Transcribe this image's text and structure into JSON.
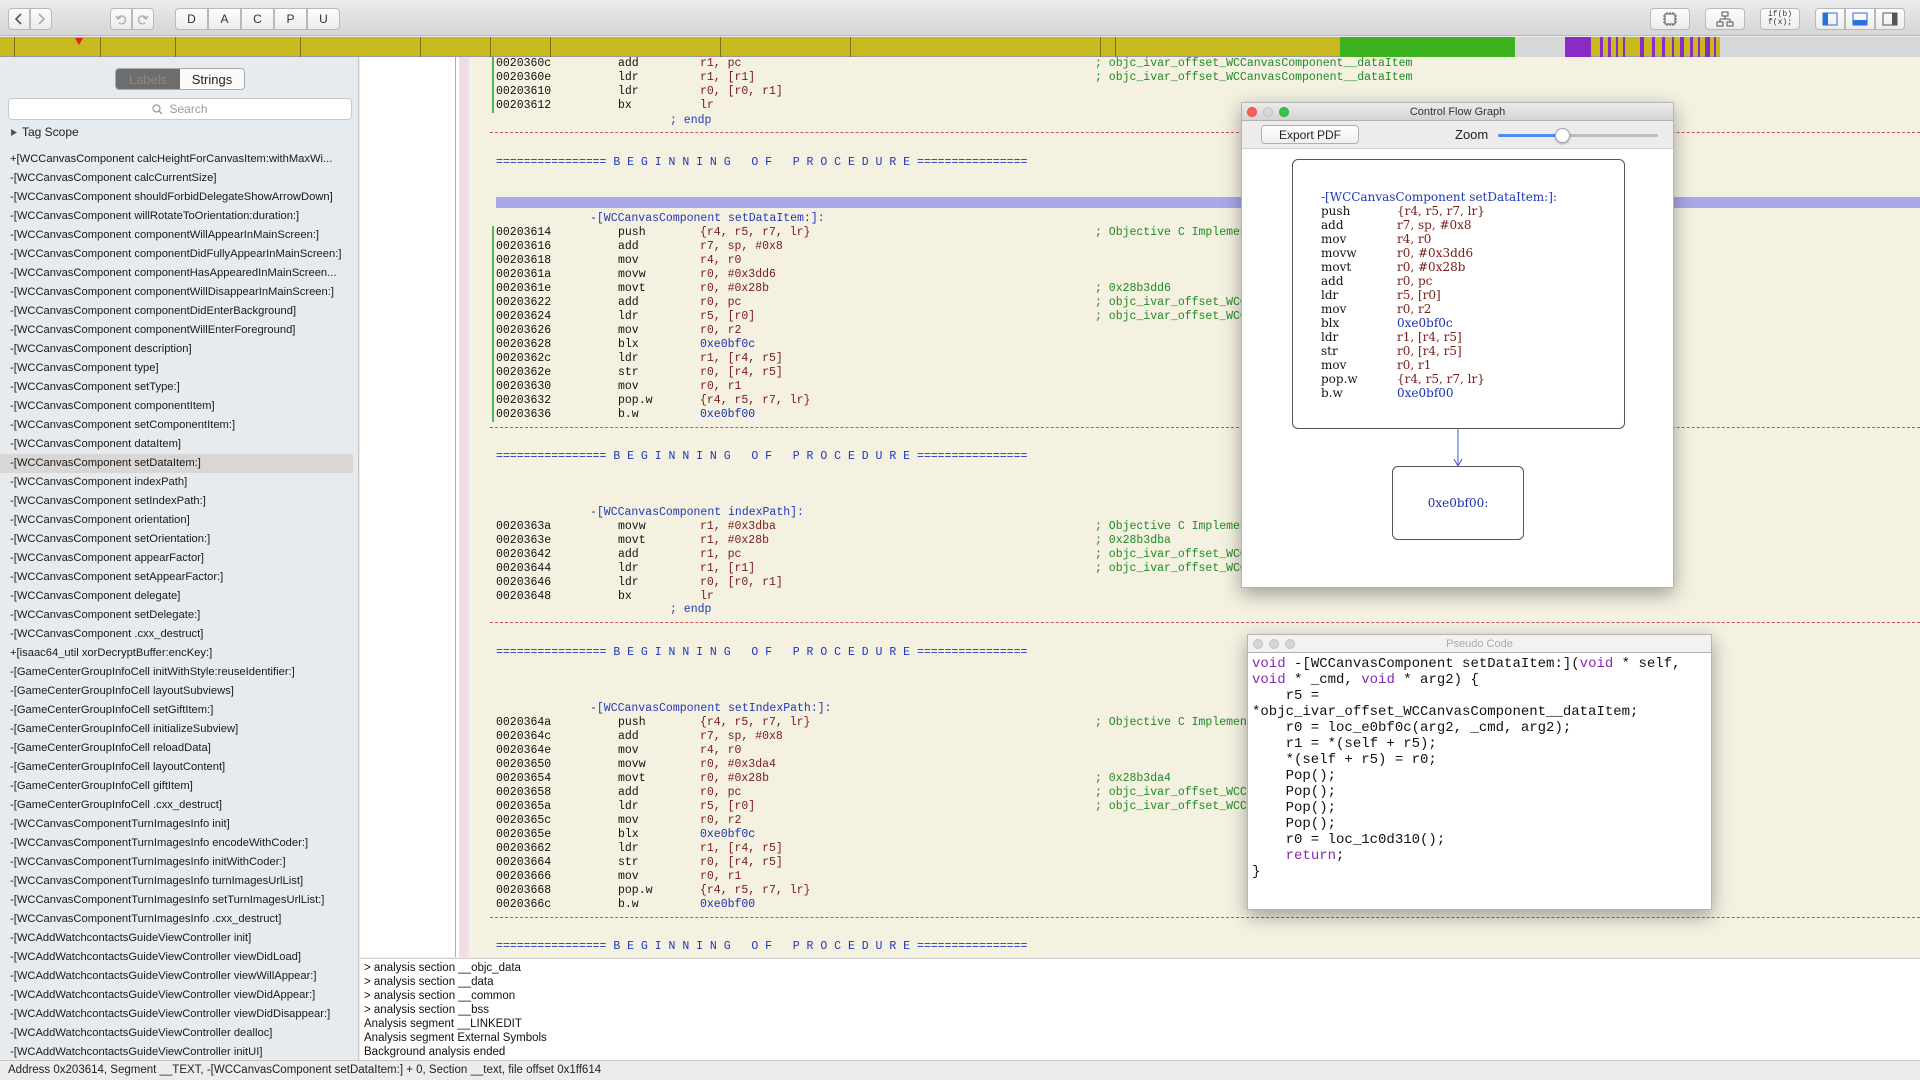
{
  "toolbar": {
    "mode_buttons": [
      "D",
      "A",
      "C",
      "P",
      "U"
    ],
    "pseudo_icon_text": "if(b)\nf(x);"
  },
  "sidebar": {
    "tabs": [
      "Labels",
      "Strings"
    ],
    "active_tab": "Labels",
    "search_placeholder": "Search",
    "tag_scope": "Tag Scope",
    "selected_index": 16,
    "items": [
      "+[WCCanvasComponent calcHeightForCanvasItem:withMaxWi...",
      "-[WCCanvasComponent calcCurrentSize]",
      "-[WCCanvasComponent shouldForbidDelegateShowArrowDown]",
      "-[WCCanvasComponent willRotateToOrientation:duration:]",
      "-[WCCanvasComponent componentWillAppearInMainScreen:]",
      "-[WCCanvasComponent componentDidFullyAppearInMainScreen:]",
      "-[WCCanvasComponent componentHasAppearedInMainScreen...",
      "-[WCCanvasComponent componentWillDisappearInMainScreen:]",
      "-[WCCanvasComponent componentDidEnterBackground]",
      "-[WCCanvasComponent componentWillEnterForeground]",
      "-[WCCanvasComponent description]",
      "-[WCCanvasComponent type]",
      "-[WCCanvasComponent setType:]",
      "-[WCCanvasComponent componentItem]",
      "-[WCCanvasComponent setComponentItem:]",
      "-[WCCanvasComponent dataItem]",
      "-[WCCanvasComponent setDataItem:]",
      "-[WCCanvasComponent indexPath]",
      "-[WCCanvasComponent setIndexPath:]",
      "-[WCCanvasComponent orientation]",
      "-[WCCanvasComponent setOrientation:]",
      "-[WCCanvasComponent appearFactor]",
      "-[WCCanvasComponent setAppearFactor:]",
      "-[WCCanvasComponent delegate]",
      "-[WCCanvasComponent setDelegate:]",
      "-[WCCanvasComponent .cxx_destruct]",
      "+[isaac64_util xorDecryptBuffer:encKey:]",
      "-[GameCenterGroupInfoCell initWithStyle:reuseIdentifier:]",
      "-[GameCenterGroupInfoCell layoutSubviews]",
      "-[GameCenterGroupInfoCell setGiftItem:]",
      "-[GameCenterGroupInfoCell initializeSubview]",
      "-[GameCenterGroupInfoCell reloadData]",
      "-[GameCenterGroupInfoCell layoutContent]",
      "-[GameCenterGroupInfoCell giftItem]",
      "-[GameCenterGroupInfoCell .cxx_destruct]",
      "-[WCCanvasComponentTurnImagesInfo init]",
      "-[WCCanvasComponentTurnImagesInfo encodeWithCoder:]",
      "-[WCCanvasComponentTurnImagesInfo initWithCoder:]",
      "-[WCCanvasComponentTurnImagesInfo turnImagesUrlList]",
      "-[WCCanvasComponentTurnImagesInfo setTurnImagesUrlList:]",
      "-[WCCanvasComponentTurnImagesInfo .cxx_destruct]",
      "-[WCAddWatchcontactsGuideViewController init]",
      "-[WCAddWatchcontactsGuideViewController viewDidLoad]",
      "-[WCAddWatchcontactsGuideViewController viewWillAppear:]",
      "-[WCAddWatchcontactsGuideViewController viewDidAppear:]",
      "-[WCAddWatchcontactsGuideViewController viewDidDisappear:]",
      "-[WCAddWatchcontactsGuideViewController dealloc]",
      "-[WCAddWatchcontactsGuideViewController initUI]"
    ]
  },
  "code": {
    "proc_banner": "================ B E G I N N I N G   O F   P R O C E D U R E ================",
    "endp": "; endp",
    "block0": [
      {
        "a": "0020360c",
        "m": "add",
        "o": "r1, pc",
        "c": "; objc_ivar_offset_WCCanvasComponent__dataItem"
      },
      {
        "a": "0020360e",
        "m": "ldr",
        "o": "r1, [r1]",
        "c": "; objc_ivar_offset_WCCanvasComponent__dataItem"
      },
      {
        "a": "00203610",
        "m": "ldr",
        "o": "r0, [r0, r1]",
        "c": ""
      },
      {
        "a": "00203612",
        "m": "bx",
        "o": "lr",
        "c": ""
      }
    ],
    "proc1_name": "-[WCCanvasComponent setDataItem:]:",
    "block1": [
      {
        "a": "00203614",
        "m": "push",
        "o": "{r4, r5, r7, lr}",
        "c": "; Objective C Implement"
      },
      {
        "a": "00203616",
        "m": "add",
        "o": "r7, sp, #0x8",
        "c": ""
      },
      {
        "a": "00203618",
        "m": "mov",
        "o": "r4, r0",
        "c": ""
      },
      {
        "a": "0020361a",
        "m": "movw",
        "o": "r0, #0x3dd6",
        "c": ""
      },
      {
        "a": "0020361e",
        "m": "movt",
        "o": "r0, #0x28b",
        "c": "; 0x28b3dd6"
      },
      {
        "a": "00203622",
        "m": "add",
        "o": "r0, pc",
        "c": "; objc_ivar_offset_WCCa"
      },
      {
        "a": "00203624",
        "m": "ldr",
        "o": "r5, [r0]",
        "c": "; objc_ivar_offset_WCCa"
      },
      {
        "a": "00203626",
        "m": "mov",
        "o": "r0, r2",
        "c": ""
      },
      {
        "a": "00203628",
        "m": "blx",
        "o": "0xe0bf0c",
        "c": ""
      },
      {
        "a": "0020362c",
        "m": "ldr",
        "o": "r1, [r4, r5]",
        "c": ""
      },
      {
        "a": "0020362e",
        "m": "str",
        "o": "r0, [r4, r5]",
        "c": ""
      },
      {
        "a": "00203630",
        "m": "mov",
        "o": "r0, r1",
        "c": ""
      },
      {
        "a": "00203632",
        "m": "pop.w",
        "o": "{r4, r5, r7, lr}",
        "c": ""
      },
      {
        "a": "00203636",
        "m": "b.w",
        "o": "0xe0bf00",
        "c": ""
      }
    ],
    "proc2_name": "-[WCCanvasComponent indexPath]:",
    "block2": [
      {
        "a": "0020363a",
        "m": "movw",
        "o": "r1, #0x3dba",
        "c": "; Objective C Implement"
      },
      {
        "a": "0020363e",
        "m": "movt",
        "o": "r1, #0x28b",
        "c": "; 0x28b3dba"
      },
      {
        "a": "00203642",
        "m": "add",
        "o": "r1, pc",
        "c": "; objc_ivar_offset_WCCa"
      },
      {
        "a": "00203644",
        "m": "ldr",
        "o": "r1, [r1]",
        "c": "; objc_ivar_offset_WCCa"
      },
      {
        "a": "00203646",
        "m": "ldr",
        "o": "r0, [r0, r1]",
        "c": ""
      },
      {
        "a": "00203648",
        "m": "bx",
        "o": "lr",
        "c": ""
      }
    ],
    "proc3_name": "-[WCCanvasComponent setIndexPath:]:",
    "block3": [
      {
        "a": "0020364a",
        "m": "push",
        "o": "{r4, r5, r7, lr}",
        "c": "; Objective C Implementa"
      },
      {
        "a": "0020364c",
        "m": "add",
        "o": "r7, sp, #0x8",
        "c": ""
      },
      {
        "a": "0020364e",
        "m": "mov",
        "o": "r4, r0",
        "c": ""
      },
      {
        "a": "00203650",
        "m": "movw",
        "o": "r0, #0x3da4",
        "c": ""
      },
      {
        "a": "00203654",
        "m": "movt",
        "o": "r0, #0x28b",
        "c": "; 0x28b3da4"
      },
      {
        "a": "00203658",
        "m": "add",
        "o": "r0, pc",
        "c": "; objc_ivar_offset_WCCan"
      },
      {
        "a": "0020365a",
        "m": "ldr",
        "o": "r5, [r0]",
        "c": "; objc_ivar_offset_WCCan"
      },
      {
        "a": "0020365c",
        "m": "mov",
        "o": "r0, r2",
        "c": ""
      },
      {
        "a": "0020365e",
        "m": "blx",
        "o": "0xe0bf0c",
        "c": ""
      },
      {
        "a": "00203662",
        "m": "ldr",
        "o": "r1, [r4, r5]",
        "c": ""
      },
      {
        "a": "00203664",
        "m": "str",
        "o": "r0, [r4, r5]",
        "c": ""
      },
      {
        "a": "00203666",
        "m": "mov",
        "o": "r0, r1",
        "c": ""
      },
      {
        "a": "00203668",
        "m": "pop.w",
        "o": "{r4, r5, r7, lr}",
        "c": ""
      },
      {
        "a": "0020366c",
        "m": "b.w",
        "o": "0xe0bf00",
        "c": ""
      }
    ]
  },
  "log": [
    "> analysis section __objc_data",
    "> analysis section __data",
    "> analysis section __common",
    "> analysis section __bss",
    "Analysis segment __LINKEDIT",
    "Analysis segment External Symbols",
    "Background analysis ended"
  ],
  "status": "Address 0x203614, Segment __TEXT, -[WCCanvasComponent setDataItem:] + 0, Section __text, file offset 0x1ff614",
  "cfg": {
    "title": "Control Flow Graph",
    "export_label": "Export PDF",
    "zoom_label": "Zoom",
    "zoom_value": 0.4,
    "node1_title": "-[WCCanvasComponent setDataItem:]:",
    "node1_lines": [
      {
        "m": "push",
        "o": "{r4, r5, r7, lr}"
      },
      {
        "m": "add",
        "o": "r7, sp, #0x8"
      },
      {
        "m": "mov",
        "o": "r4, r0"
      },
      {
        "m": "movw",
        "o": "r0, #0x3dd6"
      },
      {
        "m": "movt",
        "o": "r0, #0x28b"
      },
      {
        "m": "add",
        "o": "r0, pc"
      },
      {
        "m": "ldr",
        "o": "r5, [r0]"
      },
      {
        "m": "mov",
        "o": "r0, r2"
      },
      {
        "m": "blx",
        "o": "0xe0bf0c"
      },
      {
        "m": "ldr",
        "o": "r1, [r4, r5]"
      },
      {
        "m": "str",
        "o": "r0, [r4, r5]"
      },
      {
        "m": "mov",
        "o": "r0, r1"
      },
      {
        "m": "pop.w",
        "o": "{r4, r5, r7, lr}"
      },
      {
        "m": "b.w",
        "o": "0xe0bf00"
      }
    ],
    "node2_label": "0xe0bf00:"
  },
  "pseudo": {
    "title": "Pseudo Code",
    "lines": [
      "void -[WCCanvasComponent setDataItem:](void * self,",
      "void * _cmd, void * arg2) {",
      "    r5 =",
      "*objc_ivar_offset_WCCanvasComponent__dataItem;",
      "    r0 = loc_e0bf0c(arg2, _cmd, arg2);",
      "    r1 = *(self + r5);",
      "    *(self + r5) = r0;",
      "    Pop();",
      "    Pop();",
      "    Pop();",
      "    Pop();",
      "    r0 = loc_1c0d310();",
      "    return;",
      "}"
    ]
  },
  "colors": {
    "nav_yellow": "#c8ba1e",
    "nav_green": "#3cb21f",
    "nav_purple": "#8a2bc6",
    "code_bg": "#f4f1e1",
    "comment_green": "#1f8a24",
    "label_blue": "#2137b8"
  }
}
